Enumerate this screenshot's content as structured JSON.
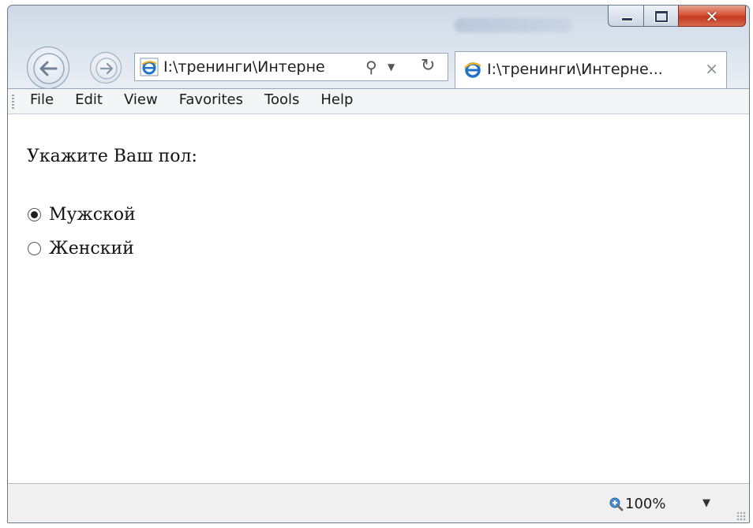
{
  "window": {
    "caption": {
      "minimize": "–",
      "maximize": "□",
      "close": "✕"
    }
  },
  "nav": {
    "back_icon": "back-arrow-icon",
    "forward_icon": "forward-arrow-icon",
    "address": "I:\\тренинги\\Интерне",
    "search_icon": "search-icon",
    "refresh_icon": "refresh-icon"
  },
  "tab": {
    "title": "I:\\тренинги\\Интерне...",
    "close": "×"
  },
  "menu": {
    "items": [
      "File",
      "Edit",
      "View",
      "Favorites",
      "Tools",
      "Help"
    ]
  },
  "content": {
    "prompt": "Укажите Ваш пол:",
    "options": [
      {
        "label": "Мужской",
        "checked": true
      },
      {
        "label": "Женский",
        "checked": false
      }
    ]
  },
  "status": {
    "zoom": "100%"
  },
  "colors": {
    "close_button": "#c4391f",
    "ie_blue": "#1e73c8",
    "ie_gold": "#f2b01e"
  }
}
